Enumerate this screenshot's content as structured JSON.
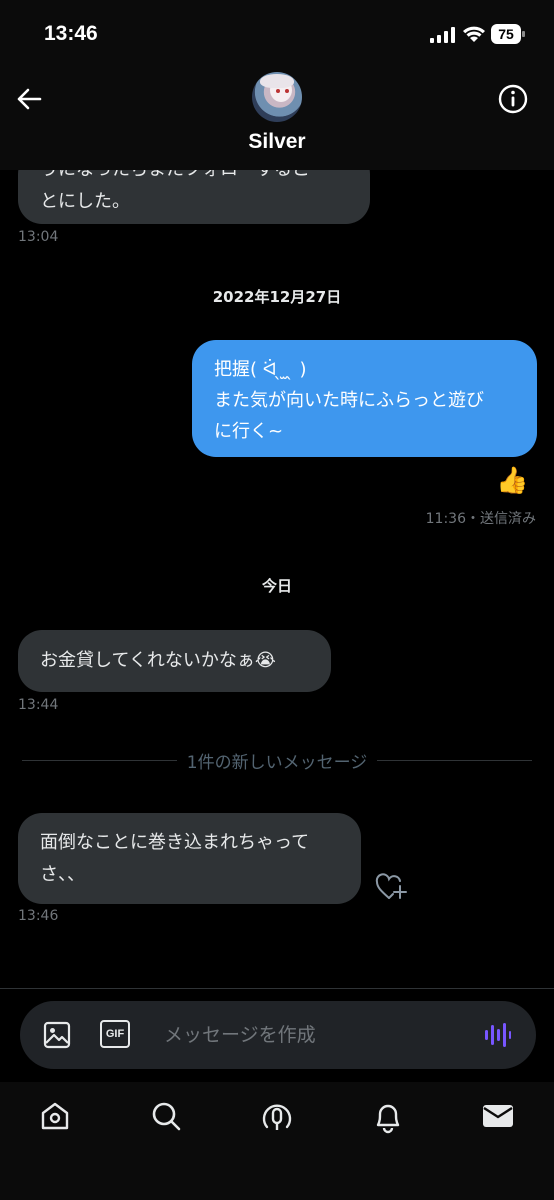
{
  "status_bar": {
    "time": "13:46",
    "battery": "75"
  },
  "header": {
    "name": "Silver",
    "back_icon": "arrow-left-icon",
    "info_icon": "info-icon"
  },
  "messages": [
    {
      "direction": "incoming",
      "lines": [
        "うになったらまたフォローするこ",
        "とにした。"
      ],
      "time": "13:04"
    },
    {
      "direction": "outgoing",
      "lines": [
        "把握( ᐛ ̖ ̫ ̖ )",
        "また気が向いた時にふらっと遊び",
        "に行く~"
      ],
      "reaction": "👍",
      "time": "11:36・送信済み"
    },
    {
      "direction": "incoming",
      "lines": [
        "お金貸してくれないかなぁ😭"
      ],
      "time": "13:44"
    },
    {
      "direction": "incoming",
      "lines": [
        "面倒なことに巻き込まれちゃって",
        "さ、、"
      ],
      "time": "13:46"
    }
  ],
  "date_separators": [
    "2022年12月27日",
    "今日"
  ],
  "new_messages_divider": "1件の新しいメッセージ",
  "composer": {
    "placeholder": "メッセージを作成",
    "gif_label": "GIF"
  },
  "tabbar": [
    "home-icon",
    "search-icon",
    "spaces-icon",
    "notifications-icon",
    "messages-icon"
  ],
  "colors": {
    "accent": "#1d9bf0",
    "outgoing_bubble": "#3e97ee",
    "incoming_bubble": "#2f3336",
    "voice_icon": "#7856ff"
  }
}
